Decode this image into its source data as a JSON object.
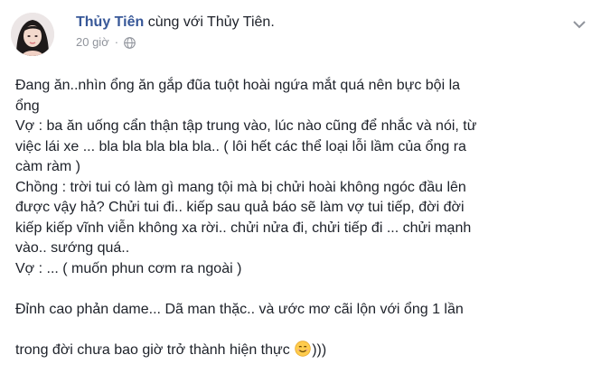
{
  "post": {
    "author": "Thủy Tiên",
    "with_text": " cùng với Thủy Tiên.",
    "time": "20 giờ",
    "dot": "·",
    "paragraphs": [
      "Đang ăn..nhìn ổng ăn gắp đũa tuột hoài ngứa mắt quá nên bực bội la\nổng",
      "Vợ : ba ăn uống cẩn thận tập trung vào, lúc nào cũng để nhắc và nói, từ\nviệc lái xe ... bla bla bla bla bla.. ( lôi hết các thể loại lỗi lầm của ổng ra\ncàm ràm )",
      "Chồng : trời tui có làm gì mang tội mà bị chửi hoài không ngóc đầu lên\nđược vậy hả? Chửi tui đi.. kiếp sau quả báo sẽ làm vợ tui tiếp, đời đời\nkiếp kiếp vĩnh viễn không xa rời.. chửi nửa đi, chửi tiếp đi ... chửi mạnh\nvào.. sướng quá..",
      "Vợ : ... ( muốn phun cơm ra ngoài )"
    ],
    "final_line_1": "Đỉnh cao phản dame... Dã man thặc.. và ước mơ cãi lộn với ổng 1 lần",
    "final_line_2_before": "trong đời chưa bao giờ trở thành hiện thực ",
    "final_line_2_after": ")))",
    "emoji": "smiling-face-emoji"
  },
  "colors": {
    "author": "#385898",
    "text": "#1d2129",
    "meta": "#90949c"
  }
}
